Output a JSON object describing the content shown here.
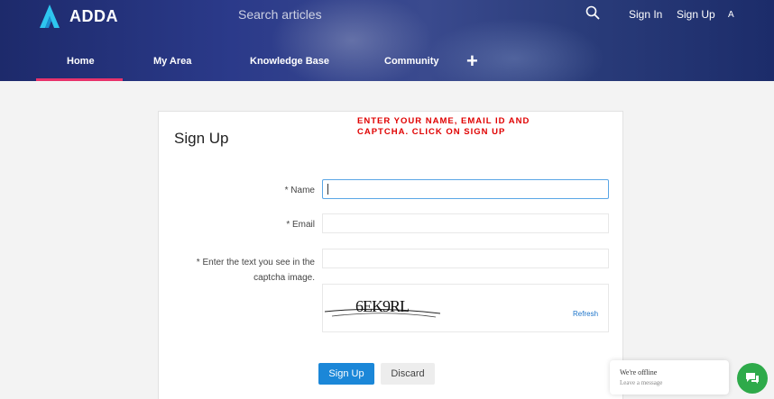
{
  "header": {
    "logo_text": "ADDA",
    "search_placeholder": "Search articles",
    "sign_in": "Sign In",
    "sign_up": "Sign Up",
    "lang": "A",
    "nav": [
      "Home",
      "My Area",
      "Knowledge Base",
      "Community"
    ],
    "active_nav": "Home"
  },
  "form": {
    "title": "Sign Up",
    "instruction": "ENTER YOUR NAME, EMAIL ID AND CAPTCHA. CLICK ON SIGN UP",
    "name_label": "* Name",
    "email_label": "* Email",
    "captcha_label_1": "* Enter the text you see in the",
    "captcha_label_2": "captcha image.",
    "name_value": "",
    "email_value": "",
    "captcha_value": "",
    "captcha_text": "6EK9RL",
    "refresh_label": "Refresh",
    "signup_button": "Sign Up",
    "discard_button": "Discard"
  },
  "chat": {
    "status": "We're offline",
    "sub": "Leave a message"
  },
  "colors": {
    "accent": "#1b87d8",
    "nav_underline": "#e8336b",
    "instruction": "#e00000",
    "chat": "#2eaa4a"
  }
}
